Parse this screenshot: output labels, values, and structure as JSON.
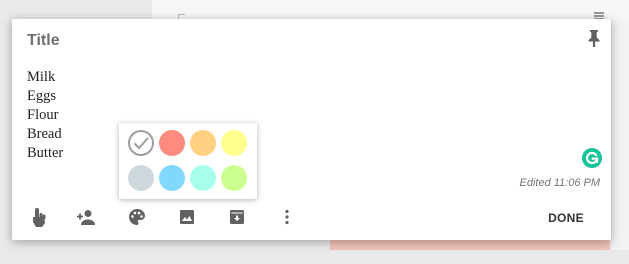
{
  "note": {
    "title": "Title",
    "lines": [
      "Milk",
      "Eggs",
      "Flour",
      "Bread",
      "Butter"
    ],
    "edited": "Edited 11:06 PM"
  },
  "toolbar": {
    "icons": [
      "remind-me-icon",
      "collaborator-icon",
      "change-color-icon",
      "add-image-icon",
      "archive-icon",
      "more-icon"
    ],
    "done_label": "DONE"
  },
  "color_picker": {
    "selected": "default",
    "colors": [
      {
        "name": "default",
        "hex": "#ffffff"
      },
      {
        "name": "red",
        "hex": "#ff8a80"
      },
      {
        "name": "orange",
        "hex": "#ffd180"
      },
      {
        "name": "yellow",
        "hex": "#ffff8d"
      },
      {
        "name": "gray",
        "hex": "#cfd8dc"
      },
      {
        "name": "blue",
        "hex": "#80d8ff"
      },
      {
        "name": "teal",
        "hex": "#a7ffeb"
      },
      {
        "name": "green",
        "hex": "#ccff90"
      }
    ]
  },
  "colors": {
    "grammarly": "#15c39a",
    "icon": "#616161"
  }
}
